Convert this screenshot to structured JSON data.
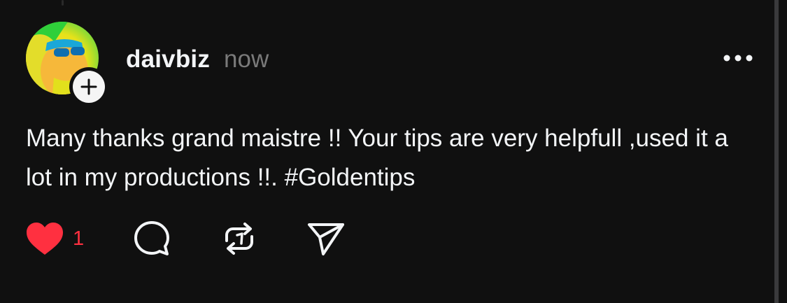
{
  "colors": {
    "background": "#101010",
    "text_primary": "#f3f5f7",
    "text_secondary": "#7a7a7a",
    "like_active": "#ff3040"
  },
  "post": {
    "author": {
      "username": "daivbiz",
      "avatar_icon": "avatar-image",
      "follow_badge_icon": "plus-icon"
    },
    "timestamp": "now",
    "more_icon": "more-options-icon",
    "text": "Many thanks grand maistre !! Your tips are very helpfull ,used it a lot in my productions !!. #Goldentips",
    "actions": {
      "like": {
        "icon": "heart-filled-icon",
        "count": "1",
        "liked": true
      },
      "reply": {
        "icon": "comment-bubble-icon"
      },
      "repost": {
        "icon": "repost-icon"
      },
      "share": {
        "icon": "send-icon"
      }
    }
  }
}
